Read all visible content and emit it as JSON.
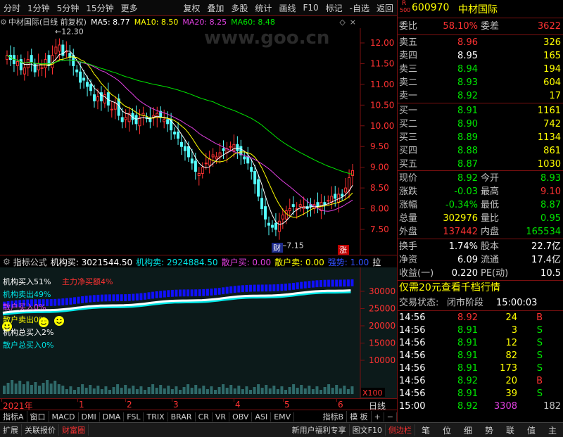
{
  "menu": {
    "left": [
      "分时",
      "1分钟",
      "5分钟",
      "15分钟",
      "更多"
    ],
    "right": [
      "复权",
      "叠加",
      "多股",
      "统计",
      "画线",
      "F10",
      "标记",
      "-自选",
      "返回"
    ]
  },
  "chart": {
    "title": "中材国际(日线 前复权)",
    "ma": [
      {
        "label": "MA5: 8.77",
        "color": "#ffffff"
      },
      {
        "label": "MA10: 8.50",
        "color": "#ffff00"
      },
      {
        "label": "MA20: 8.25",
        "color": "#e040e0"
      },
      {
        "label": "MA60: 8.48",
        "color": "#00e600"
      }
    ],
    "watermark": "www.goo.cn",
    "y_ticks": [
      "12.00",
      "11.50",
      "11.00",
      "10.50",
      "10.00",
      "9.50",
      "9.00",
      "8.50",
      "8.00",
      "7.50"
    ],
    "high_label": "12.30",
    "low_label": "7.15",
    "marker_cai": "财",
    "marker_zhang": "涨"
  },
  "indicator": {
    "header": [
      {
        "text": "指标公式",
        "color": "#d0d0d0"
      },
      {
        "text": "机构买: 3021544.50",
        "color": "#ffffff"
      },
      {
        "text": "机构卖: 2924884.50",
        "color": "#00e5e5"
      },
      {
        "text": "散户买: 0.00",
        "color": "#e040e0"
      },
      {
        "text": "散户卖: 0.00",
        "color": "#ffff00"
      },
      {
        "text": "强势: 1.00",
        "color": "#3050ff"
      },
      {
        "text": "拉",
        "color": "#ffffff"
      }
    ],
    "legend": [
      {
        "text": "机构买入51%",
        "color": "#ffffff"
      },
      {
        "text": "主力净买额4%",
        "color": "#ff3232"
      },
      {
        "text": "机构卖出49%",
        "color": "#00e5e5"
      },
      {
        "text": "散户买入0%",
        "color": "#e040e0"
      },
      {
        "text": "散户卖出0%",
        "color": "#ffff00"
      },
      {
        "text": "机构总买入2%",
        "color": "#ffffff"
      },
      {
        "text": "散户总买入0%",
        "color": "#00e5e5"
      }
    ],
    "y_ticks": [
      "30000",
      "25000",
      "20000",
      "15000",
      "10000"
    ],
    "unit": "X100"
  },
  "time_axis": {
    "labels": [
      "2021年",
      "1",
      "2",
      "3",
      "4",
      "5",
      "6"
    ],
    "period": "日线"
  },
  "tabs_row1": [
    "指标A",
    "窗口",
    "MACD",
    "DMI",
    "DMA",
    "FSL",
    "TRIX",
    "BRAR",
    "CR",
    "VR",
    "OBV",
    "ASI",
    "EMV",
    "指标B",
    "模 板",
    "+",
    "−"
  ],
  "tabs_row2": [
    "扩展",
    "关联报价",
    "财富圈",
    "新用户福利专享",
    "图文F10",
    "侧边栏"
  ],
  "tabs_row2_icons": [
    "笔",
    "位",
    "细",
    "势",
    "联",
    "值",
    "主"
  ],
  "quote": {
    "badge_top": "R",
    "badge_bottom": "500",
    "code": "600970",
    "name": "中材国际",
    "weibi_label": "委比",
    "weibi": "58.10%",
    "weicha_label": "委差",
    "weicha": "3622",
    "asks": [
      {
        "label": "卖五",
        "price": "8.96",
        "vol": "326",
        "color": "#ff3232"
      },
      {
        "label": "卖四",
        "price": "8.95",
        "vol": "165",
        "color": "#ffffff"
      },
      {
        "label": "卖三",
        "price": "8.94",
        "vol": "194",
        "color": "#00e600"
      },
      {
        "label": "卖二",
        "price": "8.93",
        "vol": "604",
        "color": "#00e600"
      },
      {
        "label": "卖一",
        "price": "8.92",
        "vol": "17",
        "color": "#00e600"
      }
    ],
    "bids": [
      {
        "label": "买一",
        "price": "8.91",
        "vol": "1161",
        "color": "#00e600"
      },
      {
        "label": "买二",
        "price": "8.90",
        "vol": "742",
        "color": "#00e600"
      },
      {
        "label": "买三",
        "price": "8.89",
        "vol": "1134",
        "color": "#00e600"
      },
      {
        "label": "买四",
        "price": "8.88",
        "vol": "861",
        "color": "#00e600"
      },
      {
        "label": "买五",
        "price": "8.87",
        "vol": "1030",
        "color": "#00e600"
      }
    ],
    "stats": [
      {
        "l1": "现价",
        "v1": "8.92",
        "c1": "#00e600",
        "l2": "今开",
        "v2": "8.93",
        "c2": "#00e600"
      },
      {
        "l1": "涨跌",
        "v1": "-0.03",
        "c1": "#00e600",
        "l2": "最高",
        "v2": "9.10",
        "c2": "#ff3232"
      },
      {
        "l1": "涨幅",
        "v1": "-0.34%",
        "c1": "#00e600",
        "l2": "最低",
        "v2": "8.87",
        "c2": "#00e600"
      },
      {
        "l1": "总量",
        "v1": "302976",
        "c1": "#ffff00",
        "l2": "量比",
        "v2": "0.95",
        "c2": "#00e600"
      },
      {
        "l1": "外盘",
        "v1": "137442",
        "c1": "#ff3232",
        "l2": "内盘",
        "v2": "165534",
        "c2": "#00e600"
      }
    ],
    "stats2": [
      {
        "l1": "换手",
        "v1": "1.74%",
        "l2": "股本",
        "v2": "22.7亿"
      },
      {
        "l1": "净资",
        "v1": "6.09",
        "l2": "流通",
        "v2": "17.4亿"
      },
      {
        "l1": "收益(一)",
        "v1": "0.220",
        "l2": "PE(动)",
        "v2": "10.5"
      }
    ],
    "promo": "仅需20元查看千档行情",
    "status_label": "交易状态:",
    "status": "闭市阶段",
    "status_time": "15:00:03",
    "ticks": [
      {
        "t": "14:56",
        "p": "8.92",
        "v": "24",
        "bs": "B",
        "pc": "#ff3232",
        "vc": "#ffff00",
        "bc": "#ff3232"
      },
      {
        "t": "14:56",
        "p": "8.91",
        "v": "3",
        "bs": "S",
        "pc": "#00e600",
        "vc": "#ffff00",
        "bc": "#00e600"
      },
      {
        "t": "14:56",
        "p": "8.91",
        "v": "12",
        "bs": "S",
        "pc": "#00e600",
        "vc": "#ffff00",
        "bc": "#00e600"
      },
      {
        "t": "14:56",
        "p": "8.91",
        "v": "82",
        "bs": "S",
        "pc": "#00e600",
        "vc": "#ffff00",
        "bc": "#00e600"
      },
      {
        "t": "14:56",
        "p": "8.91",
        "v": "173",
        "bs": "S",
        "pc": "#00e600",
        "vc": "#ffff00",
        "bc": "#00e600"
      },
      {
        "t": "14:56",
        "p": "8.92",
        "v": "20",
        "bs": "B",
        "pc": "#00e600",
        "vc": "#ffff00",
        "bc": "#ff3232"
      },
      {
        "t": "14:56",
        "p": "8.91",
        "v": "39",
        "bs": "S",
        "pc": "#00e600",
        "vc": "#ffff00",
        "bc": "#00e600"
      },
      {
        "t": "15:00",
        "p": "8.92",
        "v": "3308",
        "bs": "182",
        "pc": "#00e600",
        "vc": "#e040e0",
        "bc": "#c0c0c0"
      }
    ]
  }
}
